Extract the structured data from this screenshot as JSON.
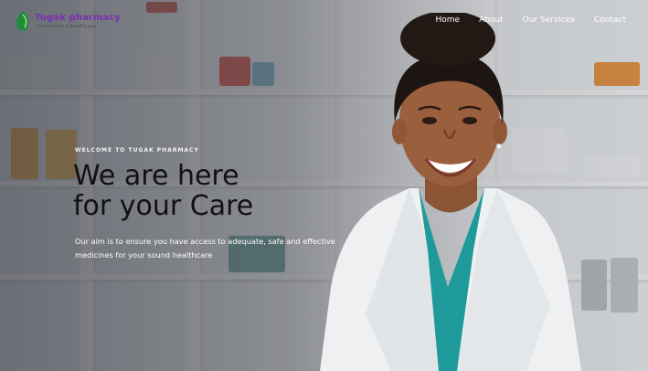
{
  "brand": {
    "name": "Tugak pharmacy",
    "tagline": "...focused on a healthy you",
    "colors": {
      "name": "#7a2fb0",
      "leaf": "#1e8a3a"
    }
  },
  "nav": {
    "items": [
      {
        "label": "Home"
      },
      {
        "label": "About"
      },
      {
        "label": "Our Services"
      },
      {
        "label": "Contact"
      }
    ]
  },
  "hero": {
    "eyebrow": "WELCOME TO TUGAK PHARMACY",
    "headline_line1": "We are here",
    "headline_line2": "for your Care",
    "description": "Our aim is to ensure you have access to adequate, safe and effective medicines for your sound healthcare"
  },
  "icons": [
    "leaf-logo-icon"
  ]
}
